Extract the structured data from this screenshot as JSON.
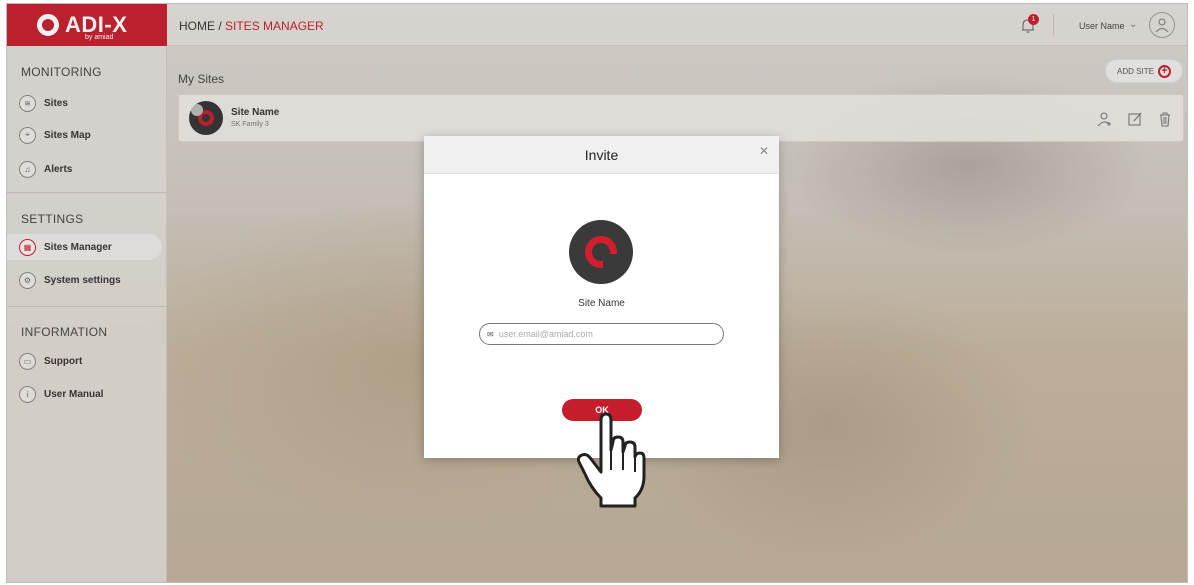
{
  "logo": {
    "text": "ADI-X",
    "sub": "by amiad"
  },
  "breadcrumb": {
    "home": "HOME / ",
    "current": "SITES MANAGER"
  },
  "header": {
    "notification_count": "1",
    "user_name": "User Name"
  },
  "sidebar": {
    "monitoring_title": "MONITORING",
    "monitoring_items": [
      {
        "label": "Sites",
        "icon": "layers-icon"
      },
      {
        "label": "Sites Map",
        "icon": "map-icon"
      },
      {
        "label": "Alerts",
        "icon": "bell-icon"
      }
    ],
    "settings_title": "SETTINGS",
    "settings_items": [
      {
        "label": "Sites Manager",
        "icon": "sites-manager-icon",
        "active": true
      },
      {
        "label": "System settings",
        "icon": "gear-icon"
      }
    ],
    "information_title": "INFORMATION",
    "information_items": [
      {
        "label": "Support",
        "icon": "chat-icon"
      },
      {
        "label": "User Manual",
        "icon": "info-icon"
      }
    ]
  },
  "content": {
    "title": "My Sites",
    "add_site_label": "ADD SITE",
    "site_card": {
      "name": "Site Name",
      "family": "SK Family 3"
    }
  },
  "modal": {
    "title": "Invite",
    "site_name": "Site Name",
    "email_placeholder": "user.email@amiad.com",
    "ok_label": "OK"
  },
  "colors": {
    "brand": "#c41e2c"
  }
}
